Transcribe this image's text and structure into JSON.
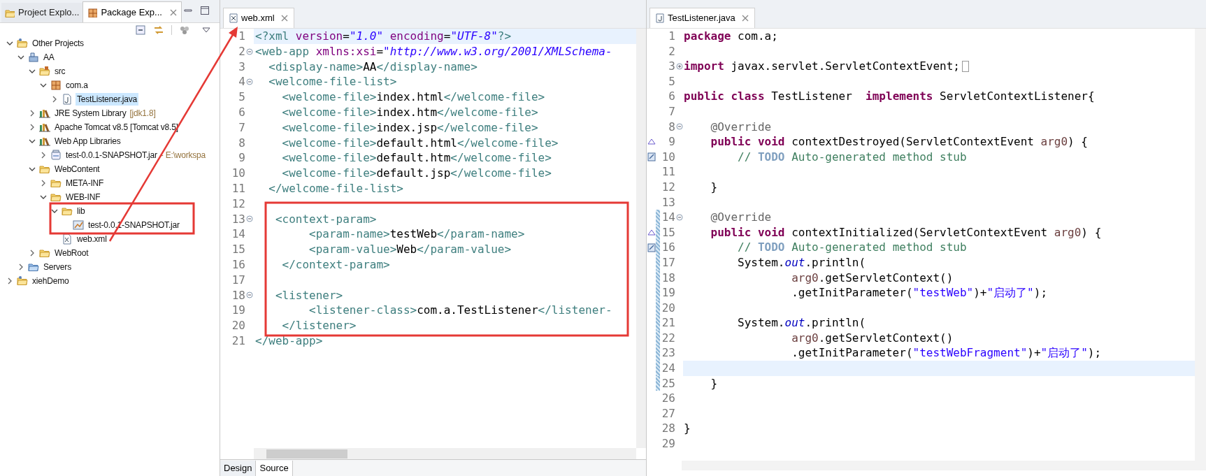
{
  "explorer": {
    "tabs": [
      {
        "label": "Project Explo...",
        "selected": false
      },
      {
        "label": "Package Exp...",
        "selected": true
      }
    ],
    "tree": [
      {
        "label": "Other Projects",
        "kind": "working-set",
        "expanded": true,
        "selected": false,
        "children": [
          {
            "label": "AA",
            "kind": "project",
            "expanded": true,
            "selected": false,
            "children": [
              {
                "label": "src",
                "kind": "source-folder",
                "expanded": true,
                "selected": false,
                "children": [
                  {
                    "label": "com.a",
                    "kind": "package",
                    "expanded": true,
                    "selected": false,
                    "children": [
                      {
                        "label": "TestListener.java",
                        "kind": "java-file",
                        "expanded": false,
                        "selected": true
                      }
                    ]
                  }
                ]
              },
              {
                "label": "JRE System Library",
                "decoration": "[jdk1.8]",
                "kind": "library",
                "expanded": false,
                "selected": false
              },
              {
                "label": "Apache Tomcat v8.5 [Tomcat v8.5]",
                "kind": "library",
                "expanded": false,
                "selected": false
              },
              {
                "label": "Web App Libraries",
                "kind": "library",
                "expanded": true,
                "selected": false,
                "children": [
                  {
                    "label": "test-0.0.1-SNAPSHOT.jar",
                    "decoration": "- E:\\workspa",
                    "kind": "jar",
                    "expanded": false,
                    "selected": false
                  }
                ]
              },
              {
                "label": "WebContent",
                "kind": "folder",
                "expanded": true,
                "selected": false,
                "children": [
                  {
                    "label": "META-INF",
                    "kind": "folder",
                    "expanded": false,
                    "selected": false
                  },
                  {
                    "label": "WEB-INF",
                    "kind": "folder",
                    "expanded": true,
                    "selected": false,
                    "children": [
                      {
                        "label": "lib",
                        "kind": "folder",
                        "expanded": true,
                        "selected": false,
                        "children": [
                          {
                            "label": "test-0.0.1-SNAPSHOT.jar",
                            "kind": "jar-file",
                            "selected": false
                          }
                        ]
                      },
                      {
                        "label": "web.xml",
                        "kind": "xml-file",
                        "selected": false
                      }
                    ]
                  }
                ]
              },
              {
                "label": "WebRoot",
                "kind": "folder",
                "expanded": false,
                "selected": false
              }
            ]
          },
          {
            "label": "Servers",
            "kind": "servers-folder",
            "expanded": false,
            "selected": false
          }
        ]
      },
      {
        "label": "xiehDemo",
        "kind": "working-set",
        "expanded": false,
        "selected": false
      }
    ]
  },
  "xml_editor": {
    "tab": "web.xml",
    "bottom_tabs": [
      {
        "label": "Design",
        "selected": false
      },
      {
        "label": "Source",
        "selected": true
      }
    ],
    "lines": [
      {
        "number": "1",
        "current": true,
        "tokens": [
          {
            "kind": "tag",
            "text": "<?xml"
          },
          {
            "kind": "attr",
            "text": " version"
          },
          {
            "kind": "plain",
            "text": "="
          },
          {
            "kind": "value",
            "text": "\"1.0\""
          },
          {
            "kind": "attr",
            "text": " encoding"
          },
          {
            "kind": "plain",
            "text": "="
          },
          {
            "kind": "value",
            "text": "\"UTF-8\""
          },
          {
            "kind": "tag",
            "text": "?>"
          }
        ]
      },
      {
        "number": "2",
        "folded": false,
        "current": false,
        "tokens": [
          {
            "kind": "tag",
            "text": "<web-app"
          },
          {
            "kind": "attr",
            "text": " xmlns:xsi"
          },
          {
            "kind": "plain",
            "text": "="
          },
          {
            "kind": "value",
            "text": "\"http://www.w3.org/2001/XMLSchema-"
          }
        ]
      },
      {
        "number": "3",
        "current": false,
        "tokens": [
          {
            "kind": "tag",
            "text": "  <display-name>"
          },
          {
            "kind": "text",
            "text": "AA"
          },
          {
            "kind": "tag",
            "text": "</display-name>"
          }
        ]
      },
      {
        "number": "4",
        "folded": false,
        "current": false,
        "tokens": [
          {
            "kind": "tag",
            "text": "  <welcome-file-list>"
          }
        ]
      },
      {
        "number": "5",
        "current": false,
        "tokens": [
          {
            "kind": "tag",
            "text": "    <welcome-file>"
          },
          {
            "kind": "text",
            "text": "index.html"
          },
          {
            "kind": "tag",
            "text": "</welcome-file>"
          }
        ]
      },
      {
        "number": "6",
        "current": false,
        "tokens": [
          {
            "kind": "tag",
            "text": "    <welcome-file>"
          },
          {
            "kind": "text",
            "text": "index.htm"
          },
          {
            "kind": "tag",
            "text": "</welcome-file>"
          }
        ]
      },
      {
        "number": "7",
        "current": false,
        "tokens": [
          {
            "kind": "tag",
            "text": "    <welcome-file>"
          },
          {
            "kind": "text",
            "text": "index.jsp"
          },
          {
            "kind": "tag",
            "text": "</welcome-file>"
          }
        ]
      },
      {
        "number": "8",
        "current": false,
        "tokens": [
          {
            "kind": "tag",
            "text": "    <welcome-file>"
          },
          {
            "kind": "text",
            "text": "default.html"
          },
          {
            "kind": "tag",
            "text": "</welcome-file>"
          }
        ]
      },
      {
        "number": "9",
        "current": false,
        "tokens": [
          {
            "kind": "tag",
            "text": "    <welcome-file>"
          },
          {
            "kind": "text",
            "text": "default.htm"
          },
          {
            "kind": "tag",
            "text": "</welcome-file>"
          }
        ]
      },
      {
        "number": "10",
        "current": false,
        "tokens": [
          {
            "kind": "tag",
            "text": "    <welcome-file>"
          },
          {
            "kind": "text",
            "text": "default.jsp"
          },
          {
            "kind": "tag",
            "text": "</welcome-file>"
          }
        ]
      },
      {
        "number": "11",
        "current": false,
        "tokens": [
          {
            "kind": "tag",
            "text": "  </welcome-file-list>"
          }
        ]
      },
      {
        "number": "12",
        "current": false
      },
      {
        "number": "13",
        "folded": false,
        "current": false,
        "tokens": [
          {
            "kind": "tag",
            "text": "   <context-param>"
          }
        ]
      },
      {
        "number": "14",
        "current": false,
        "tokens": [
          {
            "kind": "tag",
            "text": "        <param-name>"
          },
          {
            "kind": "text",
            "text": "testWeb"
          },
          {
            "kind": "tag",
            "text": "</param-name>"
          }
        ]
      },
      {
        "number": "15",
        "current": false,
        "tokens": [
          {
            "kind": "tag",
            "text": "        <param-value>"
          },
          {
            "kind": "text",
            "text": "Web"
          },
          {
            "kind": "tag",
            "text": "</param-value>"
          }
        ]
      },
      {
        "number": "16",
        "current": false,
        "tokens": [
          {
            "kind": "tag",
            "text": "    </context-param>"
          }
        ]
      },
      {
        "number": "17",
        "current": false
      },
      {
        "number": "18",
        "folded": false,
        "current": false,
        "tokens": [
          {
            "kind": "tag",
            "text": "   <listener>"
          }
        ]
      },
      {
        "number": "19",
        "current": false,
        "tokens": [
          {
            "kind": "tag",
            "text": "        <listener-class>"
          },
          {
            "kind": "text",
            "text": "com.a.TestListener"
          },
          {
            "kind": "tag",
            "text": "</listener-"
          }
        ]
      },
      {
        "number": "20",
        "current": false,
        "tokens": [
          {
            "kind": "tag",
            "text": "    </listener>"
          }
        ]
      },
      {
        "number": "21",
        "current": false,
        "tokens": [
          {
            "kind": "tag",
            "text": "</web-app>"
          }
        ]
      }
    ]
  },
  "java_editor": {
    "tab": "TestListener.java",
    "lines": [
      {
        "number": "1",
        "override": false,
        "task": false,
        "changed": false,
        "current": false,
        "tokens": [
          {
            "kind": "keyword",
            "text": "package"
          },
          {
            "kind": "plain",
            "text": " com.a;"
          }
        ]
      },
      {
        "number": "2",
        "override": false,
        "task": false,
        "changed": false,
        "current": false
      },
      {
        "number": "3",
        "folded": true,
        "override": false,
        "task": false,
        "changed": false,
        "current": false,
        "tokens": [
          {
            "kind": "keyword",
            "text": "import"
          },
          {
            "kind": "plain",
            "text": " javax.servlet.ServletContextEvent;"
          }
        ]
      },
      {
        "number": "5",
        "override": false,
        "task": false,
        "changed": false,
        "current": false
      },
      {
        "number": "6",
        "override": false,
        "task": false,
        "changed": false,
        "current": false,
        "tokens": [
          {
            "kind": "keyword",
            "text": "public"
          },
          {
            "kind": "keyword",
            "text": " class"
          },
          {
            "kind": "plain",
            "text": " TestListener"
          },
          {
            "kind": "keyword",
            "text": "  implements"
          },
          {
            "kind": "plain",
            "text": " ServletContextListener{"
          }
        ]
      },
      {
        "number": "7",
        "override": false,
        "task": false,
        "changed": false,
        "current": false
      },
      {
        "number": "8",
        "folded": false,
        "override": false,
        "task": false,
        "changed": false,
        "current": false,
        "tokens": [
          {
            "kind": "annotation",
            "text": "    @Override"
          }
        ]
      },
      {
        "number": "9",
        "override": true,
        "task": false,
        "changed": false,
        "current": false,
        "tokens": [
          {
            "kind": "keyword",
            "text": "    public"
          },
          {
            "kind": "keyword",
            "text": " void"
          },
          {
            "kind": "plain",
            "text": " contextDestroyed(ServletContextEvent"
          },
          {
            "kind": "param",
            "text": " arg0"
          },
          {
            "kind": "plain",
            "text": ") {"
          }
        ]
      },
      {
        "number": "10",
        "override": false,
        "task": true,
        "changed": false,
        "current": false,
        "tokens": [
          {
            "kind": "comment",
            "text": "        // "
          },
          {
            "kind": "todo",
            "text": "TODO"
          },
          {
            "kind": "comment",
            "text": " Auto-generated method stub"
          }
        ]
      },
      {
        "number": "11",
        "override": false,
        "task": false,
        "changed": false,
        "current": false
      },
      {
        "number": "12",
        "override": false,
        "task": false,
        "changed": false,
        "current": false,
        "tokens": [
          {
            "kind": "plain",
            "text": "    }"
          }
        ]
      },
      {
        "number": "13",
        "override": false,
        "task": false,
        "changed": false,
        "current": false
      },
      {
        "number": "14",
        "folded": false,
        "override": false,
        "task": false,
        "changed": true,
        "current": false,
        "tokens": [
          {
            "kind": "annotation",
            "text": "    @Override"
          }
        ]
      },
      {
        "number": "15",
        "override": true,
        "task": false,
        "changed": true,
        "current": false,
        "tokens": [
          {
            "kind": "keyword",
            "text": "    public"
          },
          {
            "kind": "keyword",
            "text": " void"
          },
          {
            "kind": "plain",
            "text": " contextInitialized(ServletContextEvent"
          },
          {
            "kind": "param",
            "text": " arg0"
          },
          {
            "kind": "plain",
            "text": ") {"
          }
        ]
      },
      {
        "number": "16",
        "override": false,
        "task": true,
        "changed": true,
        "current": false,
        "tokens": [
          {
            "kind": "comment",
            "text": "        // "
          },
          {
            "kind": "todo",
            "text": "TODO"
          },
          {
            "kind": "comment",
            "text": " Auto-generated method stub"
          }
        ]
      },
      {
        "number": "17",
        "override": false,
        "task": false,
        "changed": true,
        "current": false,
        "tokens": [
          {
            "kind": "plain",
            "text": "        System."
          },
          {
            "kind": "field",
            "text": "out"
          },
          {
            "kind": "plain",
            "text": ".println("
          }
        ]
      },
      {
        "number": "18",
        "override": false,
        "task": false,
        "changed": true,
        "current": false,
        "tokens": [
          {
            "kind": "param",
            "text": "                arg0"
          },
          {
            "kind": "plain",
            "text": ".getServletContext()"
          }
        ]
      },
      {
        "number": "19",
        "override": false,
        "task": false,
        "changed": true,
        "current": false,
        "tokens": [
          {
            "kind": "plain",
            "text": "                .getInitParameter("
          },
          {
            "kind": "string",
            "text": "\"testWeb\""
          },
          {
            "kind": "plain",
            "text": ")+"
          },
          {
            "kind": "string",
            "text": "\"启动了\""
          },
          {
            "kind": "plain",
            "text": ");"
          }
        ]
      },
      {
        "number": "20",
        "override": false,
        "task": false,
        "changed": true,
        "current": false
      },
      {
        "number": "21",
        "override": false,
        "task": false,
        "changed": true,
        "current": false,
        "tokens": [
          {
            "kind": "plain",
            "text": "        System."
          },
          {
            "kind": "field",
            "text": "out"
          },
          {
            "kind": "plain",
            "text": ".println("
          }
        ]
      },
      {
        "number": "22",
        "override": false,
        "task": false,
        "changed": true,
        "current": false,
        "tokens": [
          {
            "kind": "param",
            "text": "                arg0"
          },
          {
            "kind": "plain",
            "text": ".getServletContext()"
          }
        ]
      },
      {
        "number": "23",
        "override": false,
        "task": false,
        "changed": true,
        "current": false,
        "tokens": [
          {
            "kind": "plain",
            "text": "                .getInitParameter("
          },
          {
            "kind": "string",
            "text": "\"testWebFragment\""
          },
          {
            "kind": "plain",
            "text": ")+"
          },
          {
            "kind": "string",
            "text": "\"启动了\""
          },
          {
            "kind": "plain",
            "text": ");"
          }
        ]
      },
      {
        "number": "24",
        "override": false,
        "task": false,
        "changed": true,
        "current": true
      },
      {
        "number": "25",
        "override": false,
        "task": false,
        "changed": true,
        "current": false,
        "tokens": [
          {
            "kind": "plain",
            "text": "    }"
          }
        ]
      },
      {
        "number": "26",
        "override": false,
        "task": false,
        "changed": false,
        "current": false
      },
      {
        "number": "27",
        "override": false,
        "task": false,
        "changed": false,
        "current": false
      },
      {
        "number": "28",
        "override": false,
        "task": false,
        "changed": false,
        "current": false,
        "tokens": [
          {
            "kind": "plain",
            "text": "}"
          }
        ]
      },
      {
        "number": "29",
        "override": false,
        "task": false,
        "changed": false,
        "current": false
      }
    ]
  }
}
